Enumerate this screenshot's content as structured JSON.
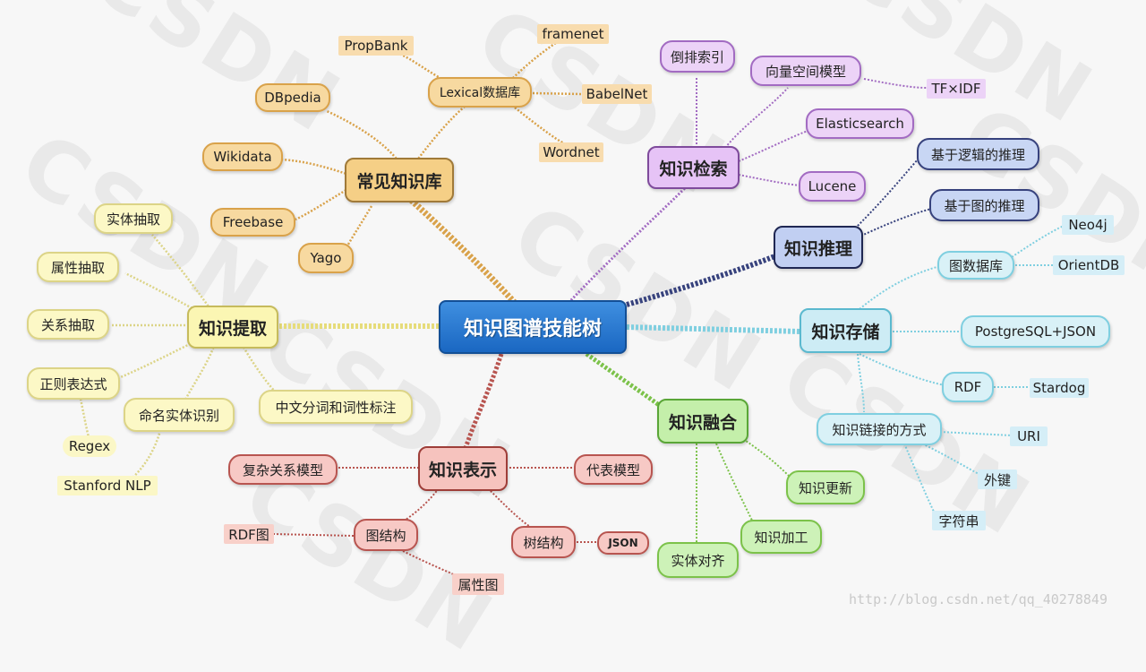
{
  "center": "知识图谱技能树",
  "branches": {
    "kb": {
      "title": "常见知识库",
      "items": [
        "DBpedia",
        "Wikidata",
        "Freebase",
        "Yago"
      ],
      "lexical": {
        "title": "Lexical数据库",
        "items": [
          "PropBank",
          "framenet",
          "BabelNet",
          "Wordnet"
        ]
      }
    },
    "retrieval": {
      "title": "知识检索",
      "items": [
        "倒排索引",
        "向量空间模型",
        "Elasticsearch",
        "Lucene"
      ],
      "vsm_child": "TF×IDF"
    },
    "reasoning": {
      "title": "知识推理",
      "items": [
        "基于逻辑的推理",
        "基于图的推理"
      ]
    },
    "storage": {
      "title": "知识存储",
      "graphdb": {
        "title": "图数据库",
        "items": [
          "Neo4j",
          "OrientDB"
        ]
      },
      "pg": "PostgreSQL+JSON",
      "rdf": {
        "title": "RDF",
        "child": "Stardog"
      },
      "link": {
        "title": "知识链接的方式",
        "items": [
          "URI",
          "外键",
          "字符串"
        ]
      }
    },
    "fusion": {
      "title": "知识融合",
      "items": [
        "知识更新",
        "知识加工",
        "实体对齐"
      ]
    },
    "representation": {
      "title": "知识表示",
      "items": [
        "复杂关系模型",
        "代表模型"
      ],
      "graph": {
        "title": "图结构",
        "items": [
          "RDF图",
          "属性图"
        ]
      },
      "tree": {
        "title": "树结构",
        "child": "JSON"
      }
    },
    "extraction": {
      "title": "知识提取",
      "items": [
        "实体抽取",
        "属性抽取",
        "关系抽取",
        "正则表达式",
        "命名实体识别",
        "中文分词和词性标注"
      ],
      "regex_children": [
        "Regex",
        "Stanford NLP"
      ]
    }
  },
  "watermark": {
    "logo": "CSDN",
    "url": "http://blog.csdn.net/qq_40278849"
  },
  "colors": {
    "center": "#1f6fca",
    "kb": "#d9a24a",
    "retrieval": "#a26bc2",
    "reasoning": "#37427d",
    "storage": "#7fcfe0",
    "extraction": "#dcd487",
    "representation": "#b85550",
    "fusion": "#7cc24a"
  }
}
